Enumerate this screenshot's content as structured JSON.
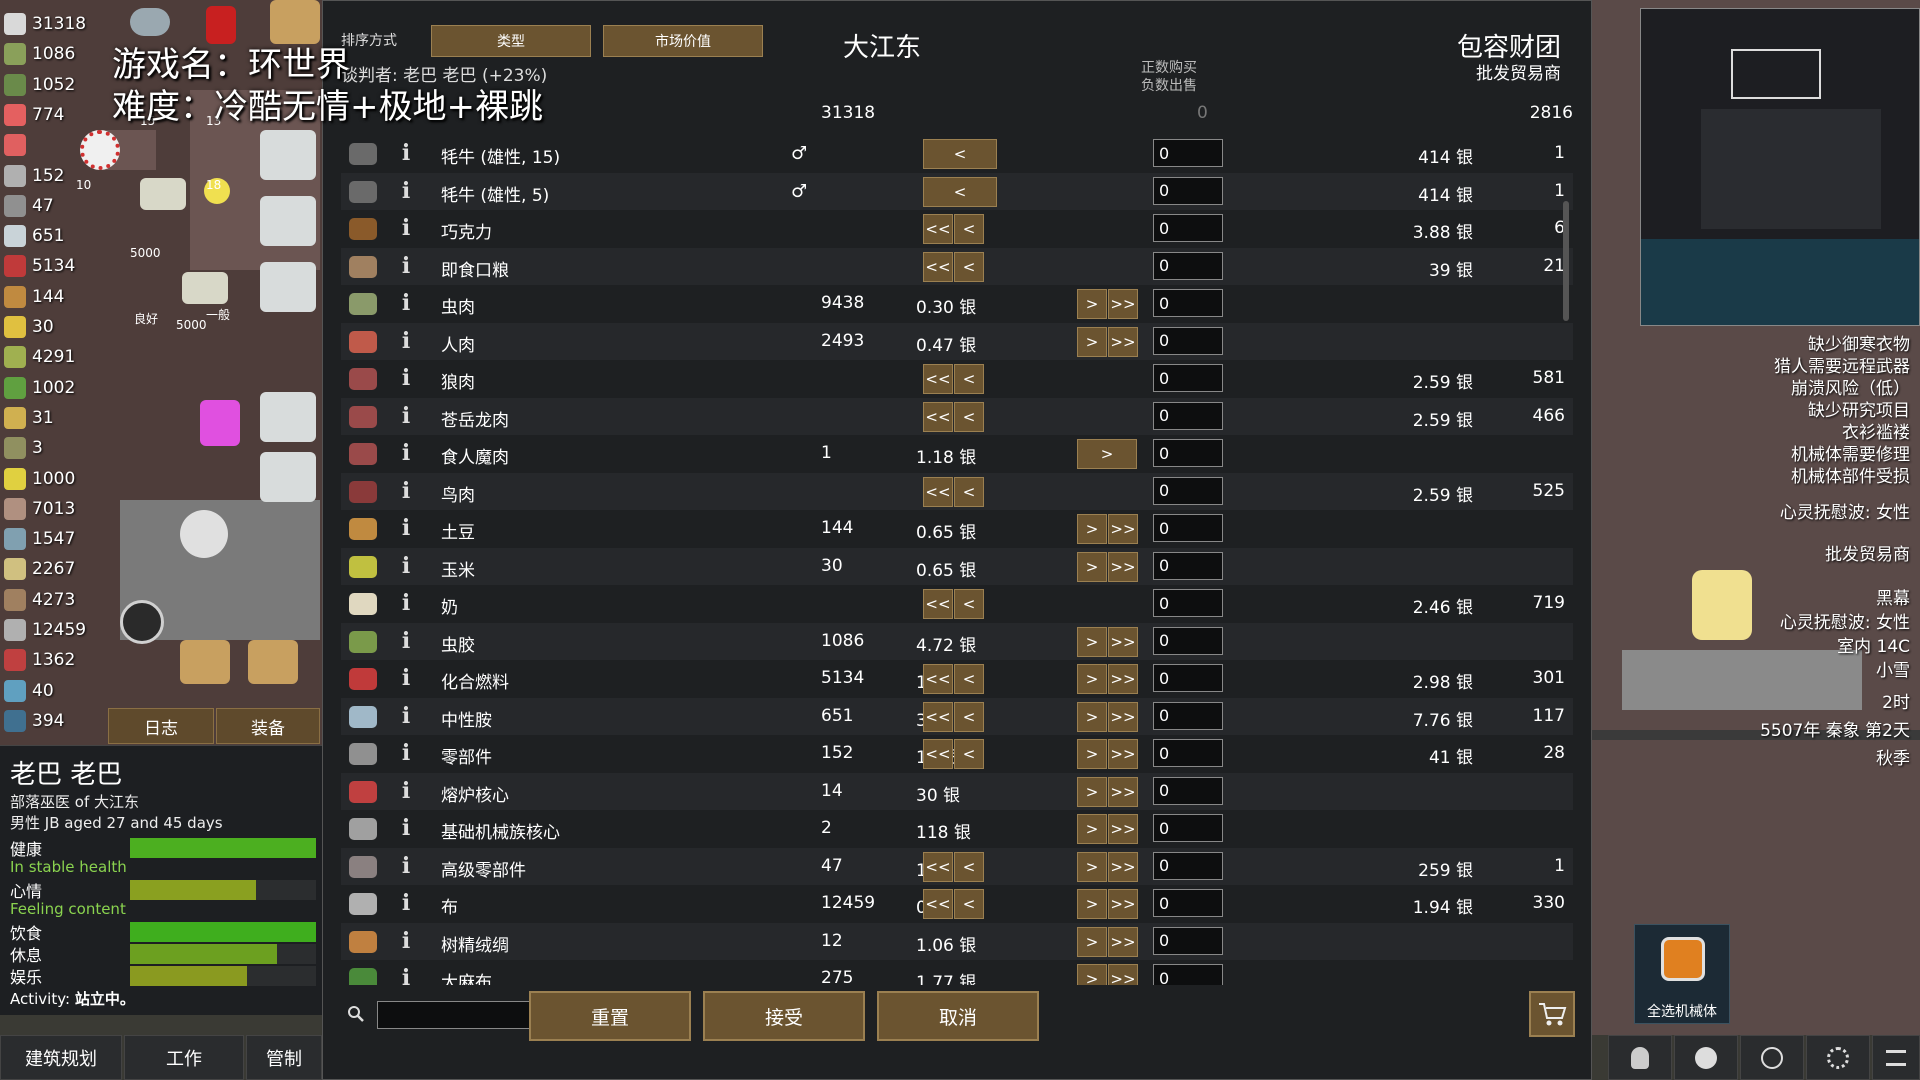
{
  "overlay": {
    "line1": "游戏名：环世界",
    "line2": "难度：冷酷无情+极地+裸跳"
  },
  "resources": [
    {
      "count": "31318",
      "color": "#d9d9d9"
    },
    {
      "count": "1086",
      "color": "#8aa05a"
    },
    {
      "count": "1052",
      "color": "#6a8a4a"
    },
    {
      "count": "774",
      "color": "#e46060"
    },
    {
      "count": "",
      "color": "#e06060"
    },
    {
      "count": "152",
      "color": "#b0b0b0"
    },
    {
      "count": "47",
      "color": "#909090"
    },
    {
      "count": "651",
      "color": "#c9d3d8"
    },
    {
      "count": "5134",
      "color": "#c03a3a"
    },
    {
      "count": "144",
      "color": "#c08a40"
    },
    {
      "count": "30",
      "color": "#e0c040"
    },
    {
      "count": "4291",
      "color": "#a0b050"
    },
    {
      "count": "1002",
      "color": "#60a040"
    },
    {
      "count": "31",
      "color": "#d0b050"
    },
    {
      "count": "3",
      "color": "#909060"
    },
    {
      "count": "1000",
      "color": "#e0d040"
    },
    {
      "count": "7013",
      "color": "#b09080"
    },
    {
      "count": "1547",
      "color": "#80a0b0"
    },
    {
      "count": "2267",
      "color": "#d0c080"
    },
    {
      "count": "4273",
      "color": "#a08060"
    },
    {
      "count": "12459",
      "color": "#b0b0b0"
    },
    {
      "count": "1362",
      "color": "#c04040"
    },
    {
      "count": "40",
      "color": "#60a0c0"
    },
    {
      "count": "394",
      "color": "#407090"
    }
  ],
  "map_labels": {
    "stack1": "5000",
    "stack2": "5000",
    "good": "良好",
    "normal": "一般",
    "n15": "15",
    "n13": "13",
    "n18": "18",
    "n10": "10"
  },
  "tabs": {
    "log": "日志",
    "gear": "装备"
  },
  "pawn": {
    "name": "老巴 老巴",
    "role": "部落巫医 of 大江东",
    "desc": "男性 JB aged 27 and 45 days",
    "health_label": "健康",
    "health_status": "In stable health",
    "mood_label": "心情",
    "mood_status": "Feeling content",
    "food_label": "饮食",
    "rest_label": "休息",
    "joy_label": "娱乐",
    "activity_label": "Activity:",
    "activity": "站立中。",
    "health": 1.0,
    "mood": 0.68,
    "food": 1.0,
    "rest": 0.79,
    "joy": 0.63
  },
  "bottom_tabs": {
    "architect": "建筑规划",
    "work": "工作",
    "restrict": "管制"
  },
  "trade": {
    "sort_label": "排序方式",
    "sort1": "类型",
    "sort2": "市场价值",
    "negotiator": "谈判者: 老巴 老巴 (+23%)",
    "colony": "大江东",
    "trader": "包容财团",
    "trader_kind": "批发贸易商",
    "pos_buy": "正数购买",
    "neg_sell": "负数出售",
    "silver_colony": "31318",
    "silver_zero": "0",
    "silver_trader": "2816",
    "reset": "重置",
    "accept": "接受",
    "cancel": "取消",
    "search_placeholder": "",
    "rows": [
      {
        "name": "牦牛 (雄性, 15)",
        "gender": "♂",
        "count": "",
        "price": "",
        "qty": "0",
        "left": [
          "<"
        ],
        "right": [],
        "tprice": "414 银",
        "tcount": "1",
        "color": "#6a6a6a"
      },
      {
        "name": "牦牛 (雄性, 5)",
        "gender": "♂",
        "count": "",
        "price": "",
        "qty": "0",
        "left": [
          "<"
        ],
        "right": [],
        "tprice": "414 银",
        "tcount": "1",
        "color": "#6a6a6a"
      },
      {
        "name": "巧克力",
        "gender": "",
        "count": "",
        "price": "",
        "qty": "0",
        "left": [
          "<<",
          "<"
        ],
        "right": [],
        "tprice": "3.88 银",
        "tcount": "6",
        "color": "#8a5a2a"
      },
      {
        "name": "即食口粮",
        "gender": "",
        "count": "",
        "price": "",
        "qty": "0",
        "left": [
          "<<",
          "<"
        ],
        "right": [],
        "tprice": "39 银",
        "tcount": "21",
        "color": "#a08060"
      },
      {
        "name": "虫肉",
        "gender": "",
        "count": "9438",
        "price": "0.30 银",
        "qty": "0",
        "left": [],
        "right": [
          ">",
          ">>"
        ],
        "tprice": "",
        "tcount": "",
        "color": "#8a9a6a"
      },
      {
        "name": "人肉",
        "gender": "",
        "count": "2493",
        "price": "0.47 银",
        "qty": "0",
        "left": [],
        "right": [
          ">",
          ">>"
        ],
        "tprice": "",
        "tcount": "",
        "color": "#c05a4a"
      },
      {
        "name": "狼肉",
        "gender": "",
        "count": "",
        "price": "",
        "qty": "0",
        "left": [
          "<<",
          "<"
        ],
        "right": [],
        "tprice": "2.59 银",
        "tcount": "581",
        "color": "#9a4a4a"
      },
      {
        "name": "苍岳龙肉",
        "gender": "",
        "count": "",
        "price": "",
        "qty": "0",
        "left": [
          "<<",
          "<"
        ],
        "right": [],
        "tprice": "2.59 银",
        "tcount": "466",
        "color": "#9a4a4a"
      },
      {
        "name": "食人魔肉",
        "gender": "",
        "count": "1",
        "price": "1.18 银",
        "qty": "0",
        "left": [],
        "right": [
          "> wide"
        ],
        "tprice": "",
        "tcount": "",
        "color": "#9a4a4a"
      },
      {
        "name": "鸟肉",
        "gender": "",
        "count": "",
        "price": "",
        "qty": "0",
        "left": [
          "<<",
          "<"
        ],
        "right": [],
        "tprice": "2.59 银",
        "tcount": "525",
        "color": "#8a3a3a"
      },
      {
        "name": "土豆",
        "gender": "",
        "count": "144",
        "price": "0.65 银",
        "qty": "0",
        "left": [],
        "right": [
          ">",
          ">>"
        ],
        "tprice": "",
        "tcount": "",
        "color": "#c08a40"
      },
      {
        "name": "玉米",
        "gender": "",
        "count": "30",
        "price": "0.65 银",
        "qty": "0",
        "left": [],
        "right": [
          ">",
          ">>"
        ],
        "tprice": "",
        "tcount": "",
        "color": "#c0c040"
      },
      {
        "name": "奶",
        "gender": "",
        "count": "",
        "price": "",
        "qty": "0",
        "left": [
          "<<",
          "<"
        ],
        "right": [],
        "tprice": "2.46 银",
        "tcount": "719",
        "color": "#e0d8c0"
      },
      {
        "name": "虫胶",
        "gender": "",
        "count": "1086",
        "price": "4.72 银",
        "qty": "0",
        "left": [],
        "right": [
          ">",
          ">>"
        ],
        "tprice": "",
        "tcount": "",
        "color": "#7a9a4a"
      },
      {
        "name": "化合燃料",
        "gender": "",
        "count": "5134",
        "price": "1.36 银",
        "qty": "0",
        "left": [
          "<<",
          "<"
        ],
        "right": [
          ">",
          ">>"
        ],
        "tprice": "2.98 银",
        "tcount": "301",
        "color": "#c03a3a"
      },
      {
        "name": "中性胺",
        "gender": "",
        "count": "651",
        "price": "3.54 银",
        "qty": "0",
        "left": [
          "<<",
          "<"
        ],
        "right": [
          ">",
          ">>"
        ],
        "tprice": "7.76 银",
        "tcount": "117",
        "color": "#a0b8c8"
      },
      {
        "name": "零部件",
        "gender": "",
        "count": "152",
        "price": "19 银",
        "qty": "0",
        "left": [
          "<<",
          "<"
        ],
        "right": [
          ">",
          ">>"
        ],
        "tprice": "41 银",
        "tcount": "28",
        "color": "#909090"
      },
      {
        "name": "熔炉核心",
        "gender": "",
        "count": "14",
        "price": "30 银",
        "qty": "0",
        "left": [],
        "right": [
          ">",
          ">>"
        ],
        "tprice": "",
        "tcount": "",
        "color": "#c04040"
      },
      {
        "name": "基础机械族核心",
        "gender": "",
        "count": "2",
        "price": "118 银",
        "qty": "0",
        "left": [],
        "right": [
          ">",
          ">>"
        ],
        "tprice": "",
        "tcount": "",
        "color": "#a0a0a0"
      },
      {
        "name": "高级零部件",
        "gender": "",
        "count": "47",
        "price": "118 银",
        "qty": "0",
        "left": [
          "<<",
          "<"
        ],
        "right": [
          ">",
          ">>"
        ],
        "tprice": "259 银",
        "tcount": "1",
        "color": "#8a8080"
      },
      {
        "name": "布",
        "gender": "",
        "count": "12459",
        "price": "0.89 银",
        "qty": "0",
        "left": [
          "<<",
          "<"
        ],
        "right": [
          ">",
          ">>"
        ],
        "tprice": "1.94 银",
        "tcount": "330",
        "color": "#b0b0b0"
      },
      {
        "name": "树精绒绸",
        "gender": "",
        "count": "12",
        "price": "1.06 银",
        "qty": "0",
        "left": [],
        "right": [
          ">",
          ">>"
        ],
        "tprice": "",
        "tcount": "",
        "color": "#c08040"
      },
      {
        "name": "大麻布",
        "gender": "",
        "count": "275",
        "price": "1.77 银",
        "qty": "0",
        "left": [],
        "right": [
          ">",
          ">>"
        ],
        "tprice": "",
        "tcount": "",
        "color": "#4a8a3a"
      }
    ]
  },
  "alerts": [
    "缺少御寒衣物",
    "猎人需要远程武器",
    "崩溃风险（低）",
    "缺少研究项目",
    "衣衫褴褛",
    "机械体需要修理",
    "机械体部件受损",
    "心灵抚慰波: 女性",
    "批发贸易商",
    "黑幕",
    "心灵抚慰波: 女性",
    "室内 14C",
    "小雪",
    "2时",
    "5507年 秦象 第2天",
    "秋季"
  ],
  "select_mech": "全选机械体",
  "colors": {
    "accent": "#6b5430",
    "health_green": "#4caf20",
    "mood_green": "#8aa020"
  }
}
